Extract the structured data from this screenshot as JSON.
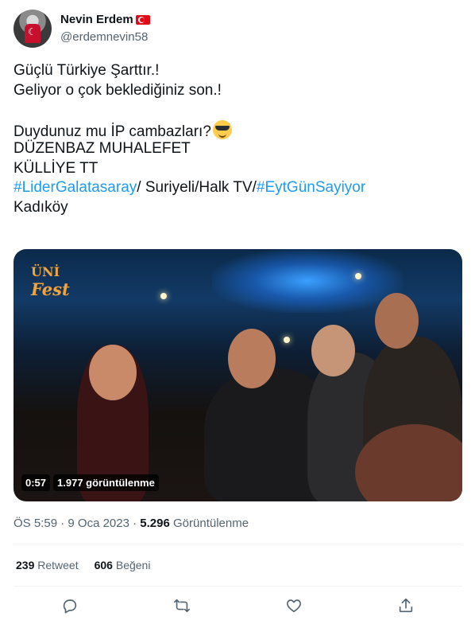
{
  "author": {
    "display_name": "Nevin Erdem",
    "handle": "@erdemnevin58",
    "flag_icon": "turkey-flag-icon",
    "avatar_icon": "profile-avatar"
  },
  "tweet": {
    "line1": "Güçlü Türkiye Şarttır.!",
    "line2": "Geliyor o çok beklediğiniz son.!",
    "line3": "Duydunuz mu İP cambazları?",
    "line3_emoji": "smiling-face-with-sunglasses-emoji",
    "line4": "DÜZENBAZ MUHALEFET",
    "line5": "KÜLLİYE TT",
    "hashtag1": "#LiderGalatasaray",
    "mid_text": "/ Suriyeli/Halk TV/",
    "hashtag2": "#EytGünSayiyor",
    "line7": "Kadıköy"
  },
  "media": {
    "logo_top": "ÜNİ",
    "logo_bottom": "Fest",
    "duration": "0:57",
    "views": "1.977 görüntülenme"
  },
  "meta": {
    "time": "ÖS 5:59",
    "separator": "·",
    "date": "9 Oca 2023",
    "views_count": "5.296",
    "views_label": "Görüntülenme"
  },
  "stats": {
    "retweets_count": "239",
    "retweets_label": "Retweet",
    "likes_count": "606",
    "likes_label": "Beğeni"
  },
  "actions": [
    "reply-icon",
    "retweet-icon",
    "like-icon",
    "share-icon"
  ],
  "colors": {
    "link": "#1d9bf0",
    "secondary_text": "#536471",
    "primary_text": "#0f1419"
  }
}
